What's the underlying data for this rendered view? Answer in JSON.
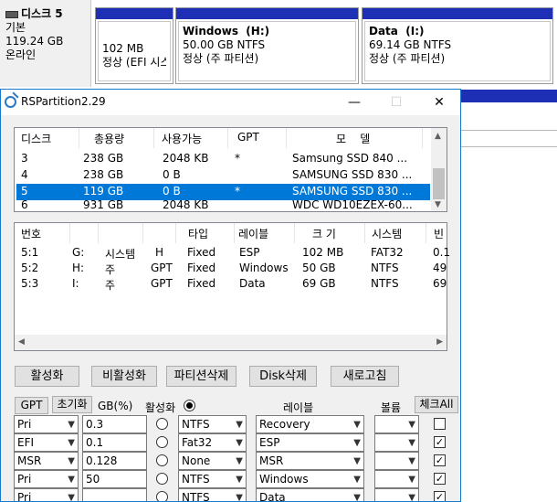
{
  "disk_management": {
    "disk": {
      "name": "디스크 5",
      "type": "기본",
      "size": "119.24 GB",
      "status": "온라인"
    },
    "partitions": [
      {
        "name": "",
        "size": "102 MB",
        "status": "정상 (EFI 시스"
      },
      {
        "name": "Windows  (H:)",
        "size": "50.00 GB NTFS",
        "status": "정상 (주 파티션)"
      },
      {
        "name": "Data  (I:)",
        "size": "69.14 GB NTFS",
        "status": "정상 (주 파티션)"
      }
    ]
  },
  "dialog": {
    "title": "RSPartition2.29",
    "minimize": "—",
    "maximize": "☐",
    "close": "✕",
    "disk_list": {
      "headers": [
        "디스크",
        "총용량",
        "사용가능",
        "GPT",
        "모    델"
      ],
      "rows": [
        {
          "disk": "3",
          "total": "238 GB",
          "free": "2048 KB",
          "gpt": "*",
          "model": "Samsung SSD 840 ..."
        },
        {
          "disk": "4",
          "total": "238 GB",
          "free": "0 B",
          "gpt": "",
          "model": "SAMSUNG SSD 830 ..."
        },
        {
          "disk": "5",
          "total": "119 GB",
          "free": "0 B",
          "gpt": "*",
          "model": "SAMSUNG SSD 830 ..."
        },
        {
          "disk": "6",
          "total": "931 GB",
          "free": "2048 KB",
          "gpt": "",
          "model": "WDC WD10EZEX-60..."
        }
      ],
      "selected_index": 2
    },
    "partition_list": {
      "headers": [
        "번호",
        "",
        "",
        "타입",
        "레이블",
        "크 기",
        "시스템",
        "빈"
      ],
      "rows": [
        {
          "num": "5:1",
          "drive": "G:",
          "kind": "시스템",
          "flag": "H",
          "type": "Fixed",
          "label": "ESP",
          "size": "102 MB",
          "fs": "FAT32",
          "free": "0.1"
        },
        {
          "num": "5:2",
          "drive": "H:",
          "kind": "주",
          "flag": "GPT",
          "type": "Fixed",
          "label": "Windows",
          "size": "50 GB",
          "fs": "NTFS",
          "free": "49"
        },
        {
          "num": "5:3",
          "drive": "I:",
          "kind": "주",
          "flag": "GPT",
          "type": "Fixed",
          "label": "Data",
          "size": "69 GB",
          "fs": "NTFS",
          "free": "69"
        }
      ]
    },
    "buttons": {
      "activate": "활성화",
      "deactivate": "비활성화",
      "delete_partition": "파티션삭제",
      "delete_disk": "Disk삭제",
      "refresh": "새로고침"
    },
    "editor": {
      "gpt_button": "GPT",
      "init_button": "초기화",
      "size_header": "GB(%)",
      "active_header": "활성화",
      "label_header": "레이블",
      "volume_header": "볼륨",
      "check_all_button": "체크All",
      "rows": [
        {
          "type": "Pri",
          "size": "0.3",
          "active": false,
          "fs": "NTFS",
          "label": "Recovery",
          "volume": "",
          "checked": false
        },
        {
          "type": "EFI",
          "size": "0.1",
          "active": false,
          "fs": "Fat32",
          "label": "ESP",
          "volume": "",
          "checked": true
        },
        {
          "type": "MSR",
          "size": "0.128",
          "active": false,
          "fs": "None",
          "label": "MSR",
          "volume": "",
          "checked": true
        },
        {
          "type": "Pri",
          "size": "50",
          "active": false,
          "fs": "NTFS",
          "label": "Windows",
          "volume": "",
          "checked": true
        },
        {
          "type": "Pri",
          "size": "",
          "active": false,
          "fs": "NTFS",
          "label": "Data",
          "volume": "",
          "checked": true
        }
      ]
    }
  },
  "colors": {
    "accent": "#0078d7",
    "partition_bar": "#1c2fb5",
    "dialog_border": "#1979ca"
  }
}
